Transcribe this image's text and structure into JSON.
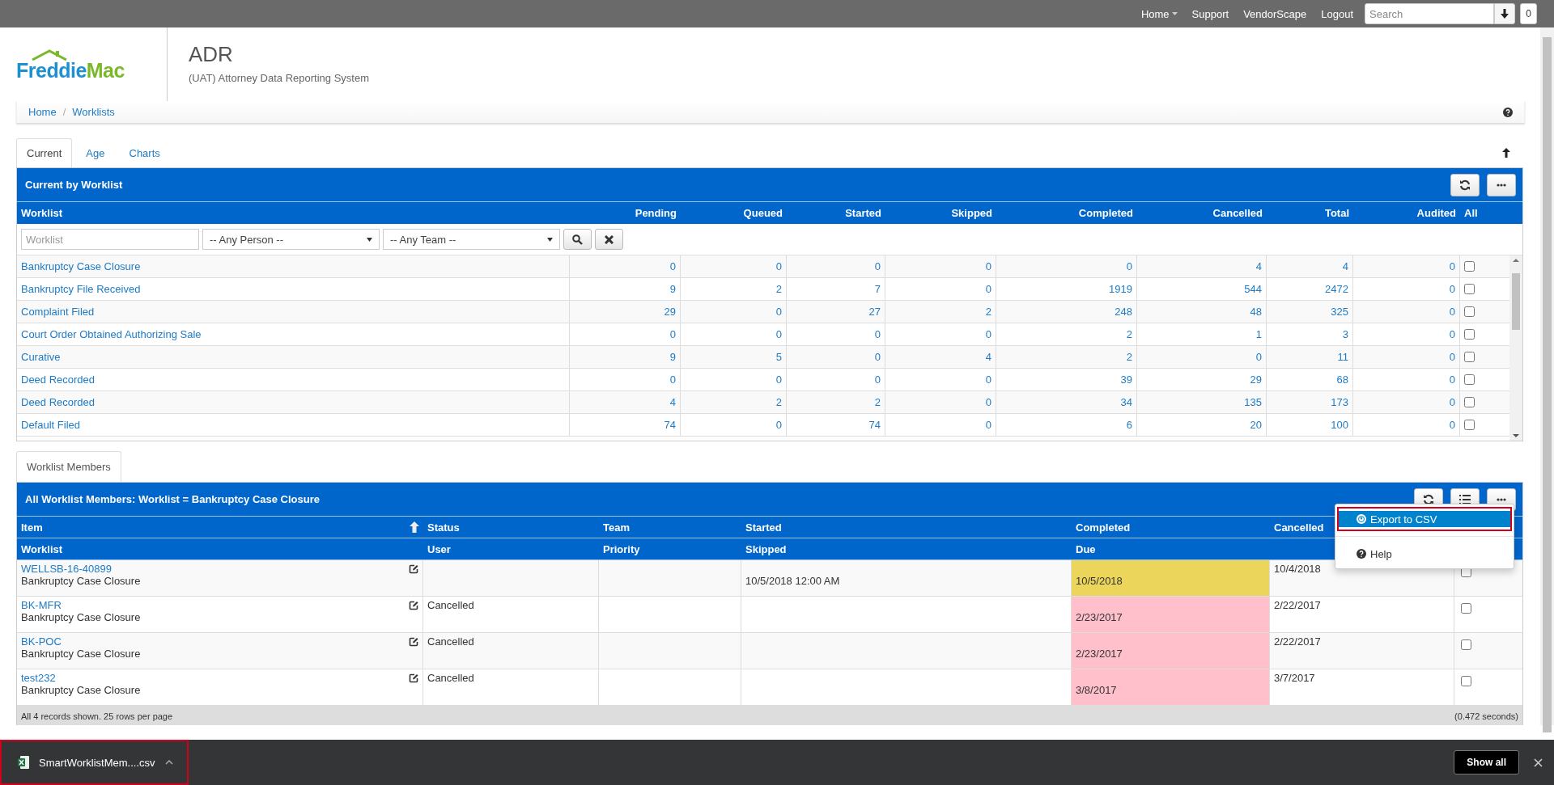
{
  "topbar": {
    "nav": [
      {
        "label": "Home",
        "dropdown": true
      },
      {
        "label": "Support",
        "dropdown": false
      },
      {
        "label": "VendorScape",
        "dropdown": false
      },
      {
        "label": "Logout",
        "dropdown": false
      }
    ],
    "search": {
      "placeholder": "Search"
    },
    "badge": "0"
  },
  "header": {
    "logo": [
      "Freddie",
      "Mac"
    ],
    "title": "ADR",
    "subtitle": "(UAT) Attorney Data Reporting System"
  },
  "breadcrumb": {
    "items": [
      "Home",
      "Worklists"
    ],
    "separator": "/"
  },
  "tabs": [
    {
      "label": "Current",
      "selected": true
    },
    {
      "label": "Age",
      "selected": false
    },
    {
      "label": "Charts",
      "selected": false
    }
  ],
  "worklist_panel": {
    "title": "Current by Worklist",
    "columns": [
      "Worklist",
      "Pending",
      "Queued",
      "Started",
      "Skipped",
      "Completed",
      "Cancelled",
      "Total",
      "Audited",
      "All"
    ],
    "filters": {
      "worklist_placeholder": "Worklist",
      "person": "-- Any Person --",
      "team": "-- Any Team --"
    },
    "rows": [
      {
        "name": "Bankruptcy Case Closure",
        "values": [
          "0",
          "0",
          "0",
          "0",
          "0",
          "4",
          "4",
          "0"
        ],
        "checked": false
      },
      {
        "name": "Bankruptcy File Received",
        "values": [
          "9",
          "2",
          "7",
          "0",
          "1919",
          "544",
          "2472",
          "0"
        ],
        "checked": false
      },
      {
        "name": "Complaint Filed",
        "values": [
          "29",
          "0",
          "27",
          "2",
          "248",
          "48",
          "325",
          "0"
        ],
        "checked": false
      },
      {
        "name": "Court Order Obtained Authorizing Sale",
        "values": [
          "0",
          "0",
          "0",
          "0",
          "2",
          "1",
          "3",
          "0"
        ],
        "checked": false
      },
      {
        "name": "Curative",
        "values": [
          "9",
          "5",
          "0",
          "4",
          "2",
          "0",
          "11",
          "0"
        ],
        "checked": false
      },
      {
        "name": "Deed Recorded",
        "values": [
          "0",
          "0",
          "0",
          "0",
          "39",
          "29",
          "68",
          "0"
        ],
        "checked": false
      },
      {
        "name": "Deed Recorded",
        "values": [
          "4",
          "2",
          "2",
          "0",
          "34",
          "135",
          "173",
          "0"
        ],
        "checked": false
      },
      {
        "name": "Default Filed",
        "values": [
          "74",
          "0",
          "74",
          "0",
          "6",
          "20",
          "100",
          "0"
        ],
        "checked": false
      }
    ]
  },
  "members_tab": {
    "label": "Worklist Members",
    "selected": true
  },
  "members_panel": {
    "title": "All Worklist Members: Worklist = Bankruptcy Case Closure",
    "header_top": [
      "Item",
      "Status",
      "Team",
      "Started",
      "Completed",
      "Cancelled"
    ],
    "header_bottom": [
      "Worklist",
      "User",
      "Priority",
      "Skipped",
      "Due"
    ],
    "rows": [
      {
        "item": "WELLSB-16-40899",
        "worklist": "Bankruptcy Case Closure",
        "skipped": "10/5/2018 12:00 AM",
        "due": {
          "text": "10/5/2018",
          "color": "#ecd55b"
        },
        "cancelled": "10/4/2018",
        "checked": false
      },
      {
        "item": "BK-MFR",
        "worklist": "Bankruptcy Case Closure",
        "status": "Cancelled",
        "due": {
          "text": "2/23/2017",
          "color": "#ffc0cb"
        },
        "cancelled": "2/22/2017",
        "checked": false
      },
      {
        "item": "BK-POC",
        "worklist": "Bankruptcy Case Closure",
        "status": "Cancelled",
        "due": {
          "text": "2/23/2017",
          "color": "#ffc0cb"
        },
        "cancelled": "2/22/2017",
        "checked": false
      },
      {
        "item": "test232",
        "worklist": "Bankruptcy Case Closure",
        "status": "Cancelled",
        "due": {
          "text": "3/8/2017",
          "color": "#ffc0cb"
        },
        "cancelled": "3/7/2017",
        "checked": false
      }
    ],
    "footer": "All 4 records shown. 25 rows per page",
    "timing": "(0.472 seconds)",
    "menu": [
      {
        "label": "Export to CSV",
        "kind": "export",
        "active": true,
        "highlighted": true
      },
      {
        "label": "Help",
        "kind": "help",
        "active": false,
        "highlighted": false
      }
    ]
  },
  "download_bar": {
    "file": "SmartWorklistMem....csv",
    "highlighted": true,
    "show_all": "Show all"
  }
}
